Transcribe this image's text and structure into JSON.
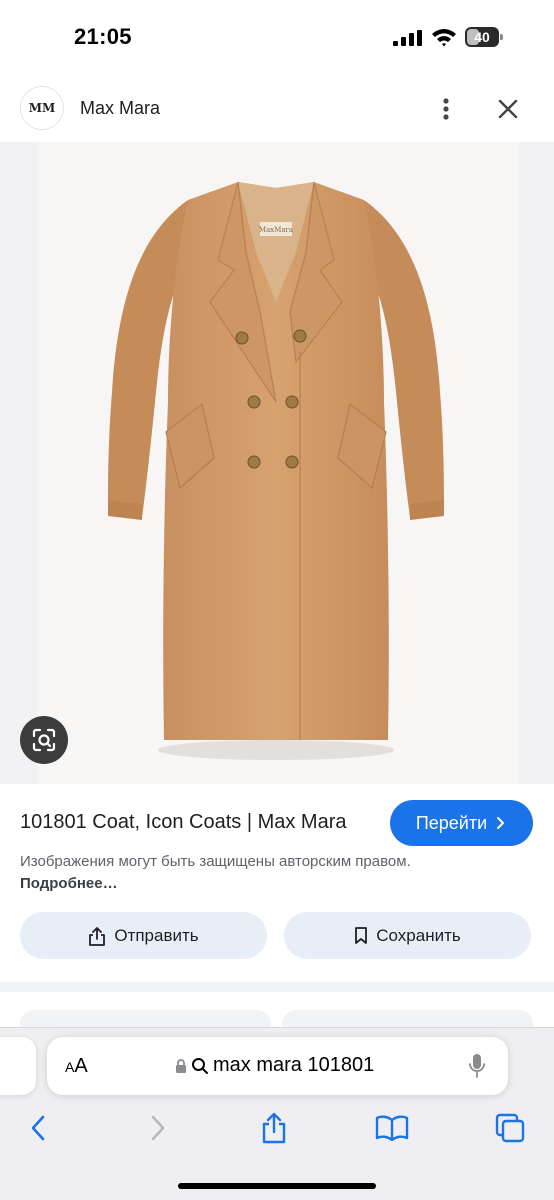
{
  "status_bar": {
    "time": "21:05",
    "battery_level": "40",
    "battery_fraction": 0.4
  },
  "site": {
    "logo_text": "MM",
    "name": "Max Mara"
  },
  "product": {
    "title": "101801 Coat, Icon Coats | Max Mara",
    "go_label": "Перейти",
    "copyright_text": "Изображения могут быть защищены авторским правом.",
    "more_link": "Подробнее…",
    "coat_label": "MaxMara"
  },
  "actions": {
    "send_label": "Отправить",
    "save_label": "Сохранить"
  },
  "browser": {
    "text_size_label": "AA",
    "url_text": "max mara 101801"
  },
  "colors": {
    "accent": "#1a73e8",
    "coat": "#d4a574",
    "pill_bg": "#e8eef8"
  },
  "icons": [
    "signal-icon",
    "wifi-icon",
    "battery-icon",
    "more-vert-icon",
    "close-icon",
    "lens-icon",
    "chevron-right-icon",
    "share-icon",
    "bookmark-icon",
    "lock-icon",
    "search-icon",
    "mic-icon",
    "back-icon",
    "forward-icon",
    "bookmarks-book-icon",
    "tabs-icon"
  ]
}
